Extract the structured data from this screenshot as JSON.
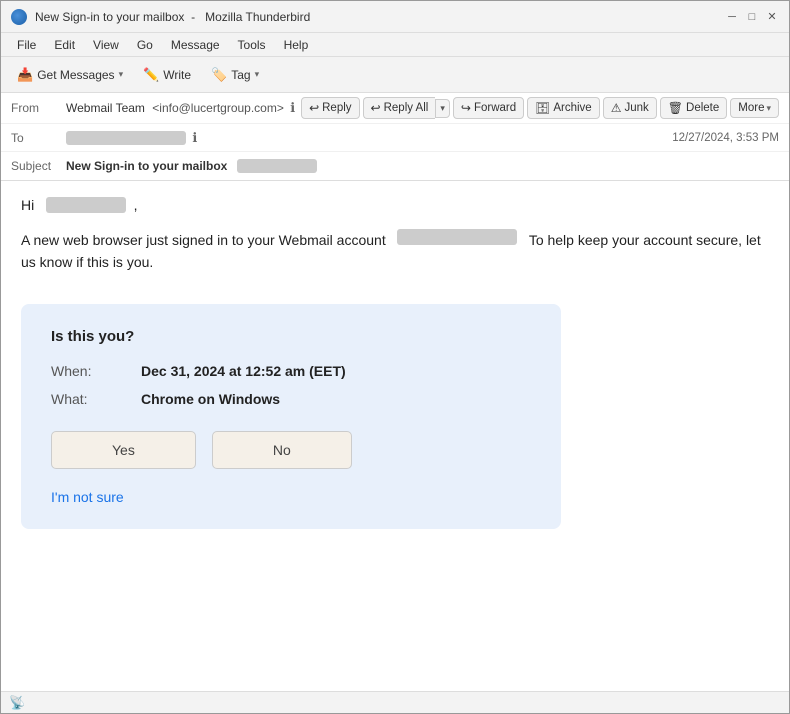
{
  "window": {
    "title_prefix": "New Sign-in to your mailbox",
    "title_app": "Mozilla Thunderbird"
  },
  "titlebar": {
    "icon_label": "thunderbird-icon",
    "minimize": "─",
    "maximize": "□",
    "close": "✕"
  },
  "menubar": {
    "items": [
      {
        "label": "File",
        "id": "file"
      },
      {
        "label": "Edit",
        "id": "edit"
      },
      {
        "label": "View",
        "id": "view"
      },
      {
        "label": "Go",
        "id": "go"
      },
      {
        "label": "Message",
        "id": "message"
      },
      {
        "label": "Tools",
        "id": "tools"
      },
      {
        "label": "Help",
        "id": "help"
      }
    ]
  },
  "toolbar": {
    "get_messages_label": "Get Messages",
    "write_label": "Write",
    "tag_label": "Tag"
  },
  "email": {
    "from_label": "From",
    "from_name": "Webmail Team",
    "from_email": "<info@lucertgroup.com>",
    "to_label": "To",
    "to_value": "████████████",
    "subject_label": "Subject",
    "subject_value": "New Sign-in to your mailbox",
    "date": "12/27/2024, 3:53 PM",
    "greeting": "Hi",
    "greeting_name": "████████ ,",
    "body_text": "A new web browser just signed in to your Webmail account",
    "body_text2": "████████████████",
    "body_text3": "To help keep your account secure, let us know if this is you.",
    "card": {
      "title": "Is this you?",
      "when_label": "When:",
      "when_value": "Dec 31, 2024 at 12:52 am (EET)",
      "what_label": "What:",
      "what_value": "Chrome on Windows",
      "yes_label": "Yes",
      "no_label": "No",
      "not_sure_label": "I'm not sure"
    }
  },
  "actions": {
    "reply_label": "Reply",
    "reply_all_label": "Reply All",
    "forward_label": "Forward",
    "archive_label": "Archive",
    "junk_label": "Junk",
    "delete_label": "Delete",
    "more_label": "More"
  },
  "colors": {
    "accent": "#1a73e8",
    "card_bg": "#e8f0fb",
    "toolbar_bg": "#f3f3f3"
  }
}
